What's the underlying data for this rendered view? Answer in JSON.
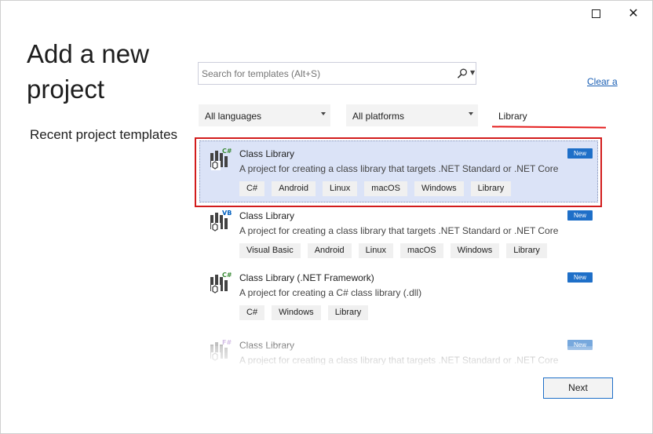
{
  "window": {
    "title": "Add a new project"
  },
  "left": {
    "title_line1": "Add a new",
    "title_line2": "project",
    "recent_title": "Recent project templates"
  },
  "search": {
    "placeholder": "Search for templates (Alt+S)"
  },
  "clear_all": "Clear a",
  "filters": {
    "language": "All languages",
    "platform": "All platforms",
    "text_filter": "Library"
  },
  "templates": [
    {
      "name": "Class Library",
      "lang_badge": "C#",
      "description": "A project for creating a class library that targets .NET Standard or .NET Core",
      "badge": "New",
      "tags": [
        "C#",
        "Android",
        "Linux",
        "macOS",
        "Windows",
        "Library"
      ],
      "selected": true
    },
    {
      "name": "Class Library",
      "lang_badge": "VB",
      "description": "A project for creating a class library that targets .NET Standard or .NET Core",
      "badge": "New",
      "tags": [
        "Visual Basic",
        "Android",
        "Linux",
        "macOS",
        "Windows",
        "Library"
      ],
      "selected": false
    },
    {
      "name": "Class Library (.NET Framework)",
      "lang_badge": "C#",
      "description": "A project for creating a C# class library (.dll)",
      "badge": "New",
      "tags": [
        "C#",
        "Windows",
        "Library"
      ],
      "selected": false
    },
    {
      "name": "Class Library",
      "lang_badge": "F#",
      "description": "A project for creating a class library that targets .NET Standard or .NET Core",
      "badge": "New",
      "tags": [],
      "selected": false
    }
  ],
  "buttons": {
    "next": "Next"
  },
  "colors": {
    "accent": "#1e6fc8",
    "highlight": "#d21c1c",
    "selection": "#dbe3f7"
  }
}
